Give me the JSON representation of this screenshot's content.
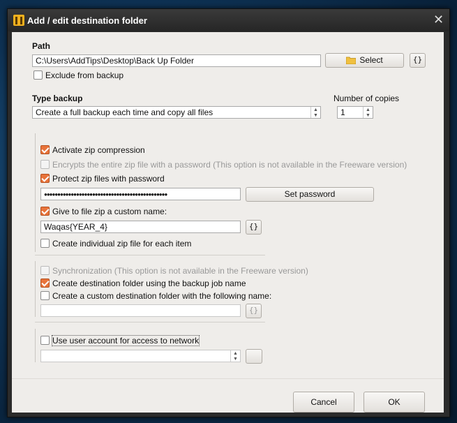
{
  "window": {
    "title": "Add / edit destination folder",
    "close_glyph": "✕"
  },
  "path": {
    "heading": "Path",
    "value": "C:\\Users\\AddTips\\Desktop\\Back Up Folder",
    "select_label": "Select",
    "vars_label": "{}",
    "exclude_label": "Exclude from backup"
  },
  "type_backup": {
    "heading": "Type backup",
    "selected": "Create a full backup each time and copy all files",
    "copies_label": "Number of copies",
    "copies_value": "1"
  },
  "zip": {
    "activate_label": "Activate zip compression",
    "encrypt_label": "Encrypts the entire zip file with a password (This option is not available in the Freeware version)",
    "protect_label": "Protect zip files with password",
    "password_mask": "●●●●●●●●●●●●●●●●●●●●●●●●●●●●●●●●●●●●●●●●●●●●●●",
    "set_password_label": "Set password",
    "custom_name_label": "Give to file zip a custom name:",
    "custom_name_value": "Waqas{YEAR_4}",
    "vars_label": "{}",
    "individual_label": "Create individual zip file for each item"
  },
  "sync": {
    "sync_label": "Synchronization (This option is not available in the Freeware version)",
    "dest_folder_label": "Create destination folder using the backup job name",
    "custom_folder_label": "Create a custom destination folder with the following name:",
    "custom_folder_value": "",
    "vars_label": "{}"
  },
  "network": {
    "use_account_label": "Use user account for access to network",
    "account_value": ""
  },
  "footer": {
    "cancel_label": "Cancel",
    "ok_label": "OK"
  },
  "colors": {
    "check_accent": "#e8733a",
    "dialog_bg": "#efedea",
    "titlebar": "#2b2b2b"
  },
  "icons": [
    "app-icon",
    "close-icon",
    "folder-icon",
    "checkmark-icon",
    "spin-arrows-icon"
  ]
}
